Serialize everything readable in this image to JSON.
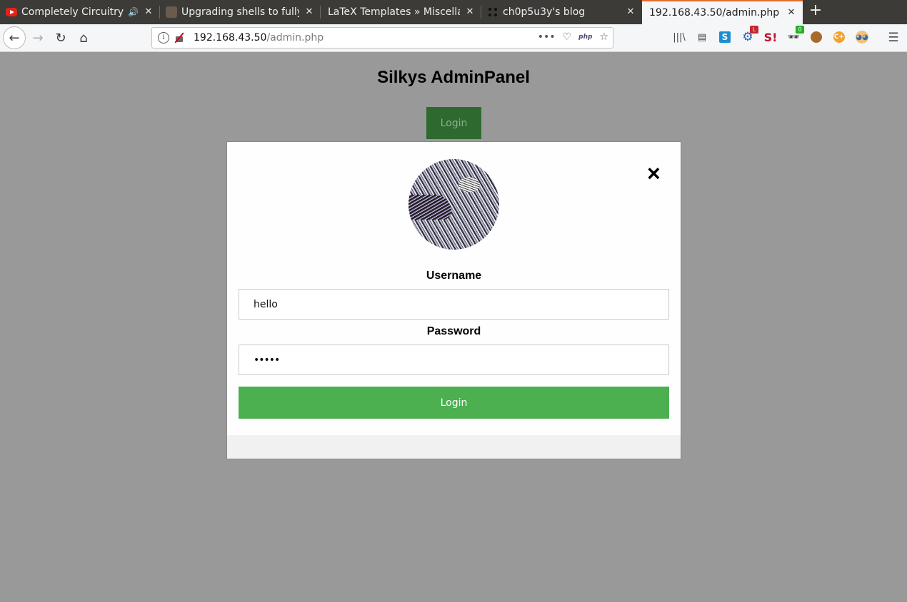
{
  "browser": {
    "tabs": [
      {
        "title": "Completely Circuitry -",
        "favicon": "youtube-icon",
        "audio": true,
        "active": false
      },
      {
        "title": "Upgrading shells to fully",
        "favicon": "avatar-icon",
        "active": false
      },
      {
        "title": "LaTeX Templates » Miscellan",
        "favicon": "",
        "active": false
      },
      {
        "title": "ch0p5u3y's blog",
        "favicon": "dots-icon",
        "active": false
      },
      {
        "title": "192.168.43.50/admin.php",
        "favicon": "",
        "active": true
      }
    ],
    "url": {
      "host": "192.168.43.50",
      "path": "/admin.php"
    },
    "url_right": {
      "more": "•••",
      "php": "php"
    },
    "badges": {
      "gear": "L",
      "spy": "0"
    },
    "new_tab": "+"
  },
  "page": {
    "title": "Silkys AdminPanel",
    "open_login_label": "Login"
  },
  "modal": {
    "close": "×",
    "username_label": "Username",
    "username_value": "hello",
    "password_label": "Password",
    "password_value": "hello",
    "submit_label": "Login"
  },
  "colors": {
    "overlay": "#999999",
    "login_green": "#4caf50",
    "open_login_bg": "#2e6a2f",
    "tab_active_accent": "#e66c2c"
  }
}
